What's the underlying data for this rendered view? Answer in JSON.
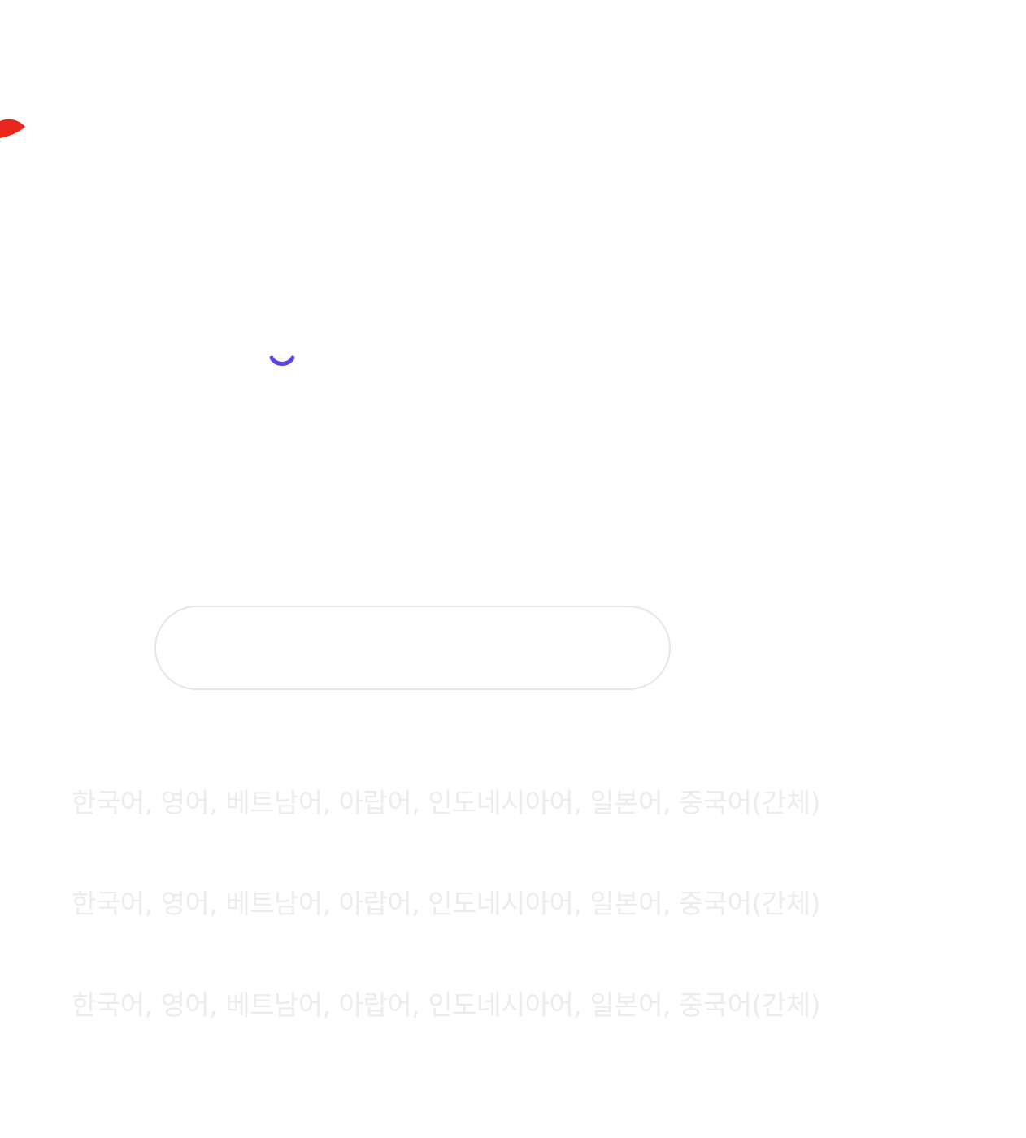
{
  "colors": {
    "accent_red": "#e8261b",
    "accent_purple": "#5a45e6",
    "field_border": "#e6e6e6",
    "faded_text": "#ececec"
  },
  "icons": {
    "brand_shape": "red-leaf-shape",
    "chevron": "chevron-down-icon"
  },
  "search": {
    "value": "",
    "placeholder": ""
  },
  "languages": [
    "한국어, 영어, 베트남어, 아랍어, 인도네시아어, 일본어, 중국어(간체)",
    "한국어, 영어, 베트남어, 아랍어, 인도네시아어, 일본어, 중국어(간체)",
    "한국어, 영어, 베트남어, 아랍어, 인도네시아어, 일본어, 중국어(간체)"
  ]
}
